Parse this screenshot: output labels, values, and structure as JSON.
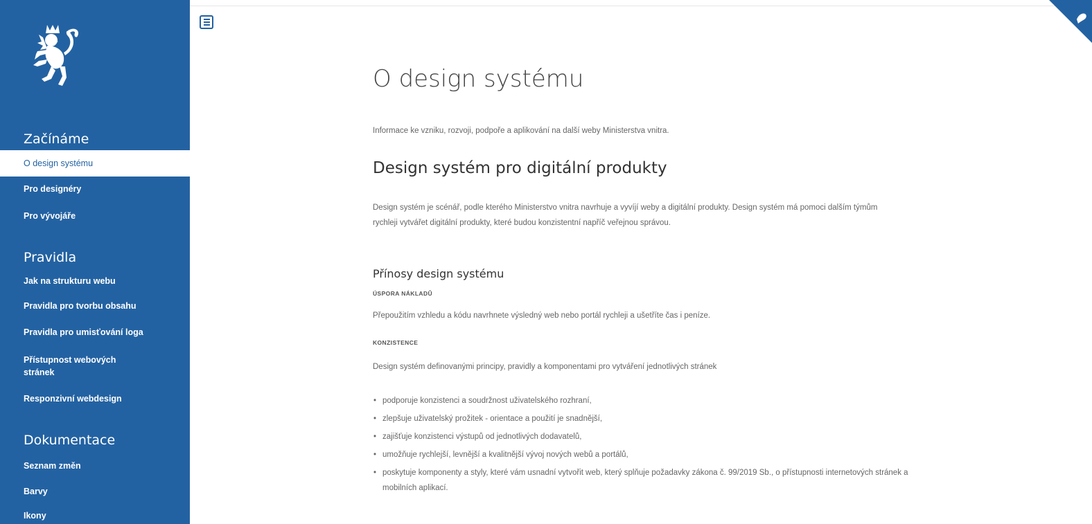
{
  "sidebar": {
    "sections": [
      {
        "title": "Začínáme",
        "items": [
          {
            "label": "O design systému",
            "active": true
          },
          {
            "label": "Pro designéry"
          },
          {
            "label": "Pro vývojáře"
          }
        ]
      },
      {
        "title": "Pravidla",
        "items": [
          {
            "label": "Jak na strukturu webu"
          },
          {
            "label": "Pravidla pro tvorbu obsahu"
          },
          {
            "label": "Pravidla pro umisťování loga"
          },
          {
            "label": "Přístupnost webových stránek"
          },
          {
            "label": "Responzivní webdesign"
          }
        ]
      },
      {
        "title": "Dokumentace",
        "items": [
          {
            "label": "Seznam změn"
          },
          {
            "label": "Barvy"
          },
          {
            "label": "Ikony"
          }
        ]
      }
    ]
  },
  "header": {
    "menu_icon": "hamburger-menu-icon",
    "corner_icon": "github-corner-icon"
  },
  "main": {
    "title": "O design systému",
    "intro": "Informace ke vzniku, rozvoji, podpoře a aplikování na další weby Ministerstva vnitra.",
    "h2": "Design systém pro digitální produkty",
    "p1": "Design systém je scénář, podle kterého Ministerstvo vnitra navrhuje a vyvíjí weby a digitální produkty. Design systém má pomoci dalším týmům rychleji vytvářet digitální produkty, které budou konzistentní napříč veřejnou správou.",
    "h3": "Přínosy design systému",
    "benefit1_title": "ÚSPORA NÁKLADŮ",
    "benefit1_text": "Přepoužitím vzhledu a kódu navrhnete výsledný web nebo portál rychleji a ušetříte čas i peníze.",
    "benefit2_title": "KONZISTENCE",
    "benefit2_text": "Design systém definovanými principy, pravidly a komponentami pro vytváření jednotlivých stránek",
    "bullets": [
      "podporuje konzistenci a soudržnost uživatelského rozhraní,",
      "zlepšuje uživatelský prožitek - orientace a použití je snadnější,",
      "zajišťuje konzistenci výstupů od jednotlivých dodavatelů,",
      "umožňuje rychlejší, levnější a kvalitnější vývoj nových webů a portálů,",
      "poskytuje komponenty a styly, které vám usnadní vytvořit web, který splňuje požadavky zákona č. 99/2019 Sb., o přístupnosti internetových stránek a mobilních aplikací."
    ]
  },
  "colors": {
    "brand_blue": "#2362a2",
    "text_gray": "#666666"
  }
}
